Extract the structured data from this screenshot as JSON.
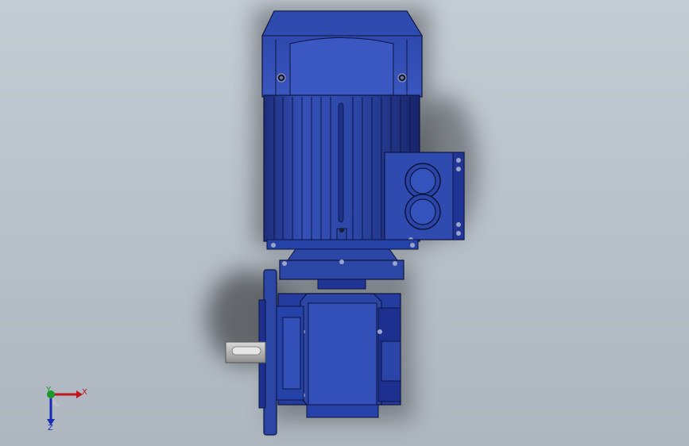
{
  "viewport": {
    "background_top": "#c4ccd4",
    "background_bottom": "#aeb6bf",
    "model_color": "#2c46a6",
    "model_shade": "#1a2a6e",
    "model_highlight": "#4763c9",
    "shaft_color": "#b7b7b7"
  },
  "triad": {
    "x_label": "X",
    "y_label": "Y",
    "z_label": "Z",
    "x_color": "#c0161c",
    "y_color": "#1a9a2a",
    "z_color": "#1a2ab8"
  }
}
